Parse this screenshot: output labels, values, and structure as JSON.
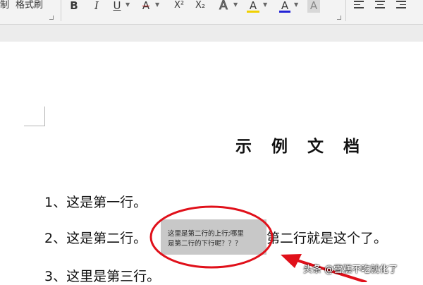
{
  "ribbon": {
    "left_label_1": "制",
    "left_label_2": "格式刷",
    "tools": {
      "bold": "B",
      "italic": "I",
      "underline": "U",
      "strike": "A",
      "superscript": "X²",
      "subscript": "X₂",
      "text_effect": "A",
      "highlight": "A",
      "font_color": "A",
      "char_shading": "A"
    },
    "icons": [
      "bold-icon",
      "italic-icon",
      "underline-icon",
      "strikethrough-icon",
      "superscript-icon",
      "subscript-icon",
      "text-effect-icon",
      "highlight-icon",
      "font-color-icon",
      "character-shading-icon",
      "align-left-icon",
      "align-center-icon",
      "align-right-icon"
    ],
    "colors": {
      "font_color_bar": "#2323d6",
      "highlight_bar": "#f0d000",
      "strike_color": "#cc2222"
    }
  },
  "document": {
    "title": "示 例 文 档",
    "line1": "1、这是第一行。",
    "line2_pre": "2、这是第二行。",
    "line2_post": "第二行就是这个了。",
    "line3": "3、这里是第三行。",
    "highlight_text_1": "这里是第二行的上行;哪里",
    "highlight_text_2": "是第二行的下行呢？？？"
  },
  "annotation": {
    "color": "#e0101a"
  },
  "watermark": "头条 @雪糕不吃就化了"
}
